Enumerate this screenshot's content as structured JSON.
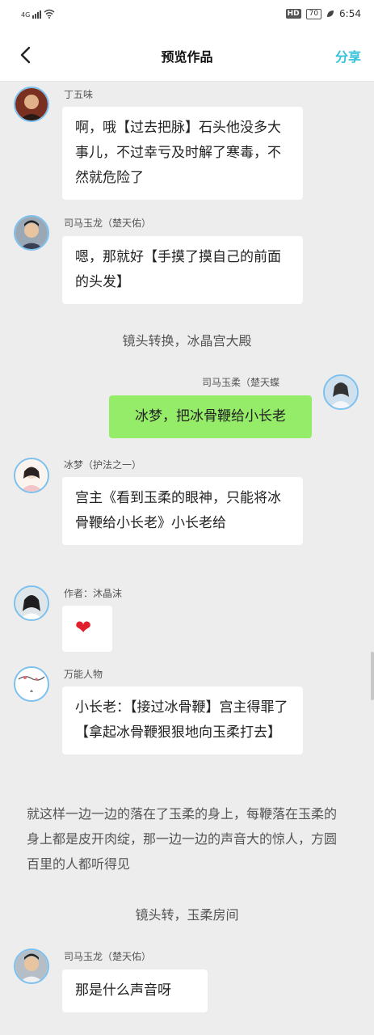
{
  "status_bar": {
    "network": "4G",
    "hd": "HD",
    "battery": "70",
    "time": "6:54"
  },
  "header": {
    "title": "预览作品",
    "share_label": "分享"
  },
  "messages": [
    {
      "sender": "丁五味",
      "text": "啊，哦【过去把脉】石头他没多大事儿，不过幸亏及时解了寒毒，不然就危险了",
      "avatar_icon": "man-portrait-icon"
    },
    {
      "sender": "司马玉龙（楚天佑）",
      "text": "嗯，那就好【手摸了摸自己的前面的头发】",
      "avatar_icon": "man-costume-icon"
    },
    {
      "sender": "司马玉柔（楚天蝶",
      "text": "冰梦，把冰骨鞭给小长老",
      "avatar_icon": "woman-costume-icon"
    },
    {
      "sender": "冰梦（护法之一）",
      "text": "宫主《看到玉柔的眼神，只能将冰骨鞭给小长老》小长老给",
      "avatar_icon": "woman-painting-icon"
    },
    {
      "sender": "作者：沐晶沫",
      "text": "❤",
      "avatar_icon": "author-avatar-icon"
    },
    {
      "sender": "万能人物",
      "text": "小长老：【接过冰骨鞭】宫主得罪了【拿起冰骨鞭狠狠地向玉柔打去】",
      "avatar_icon": "ink-painting-icon"
    },
    {
      "sender": "司马玉龙（楚天佑）",
      "text": "那是什么声音呀",
      "avatar_icon": "man-costume-icon"
    }
  ],
  "narrations": [
    "镜头转换，冰晶宫大殿",
    "镜头转，玉柔房间"
  ],
  "paragraph": "就这样一边一边的落在了玉柔的身上，每鞭落在玉柔的身上都是皮开肉绽，那一边一边的声音大的惊人，方圆百里的人都听得见",
  "colors": {
    "accent": "#36c2d8",
    "bubble_self": "#95ec69",
    "heart": "#e0202c"
  }
}
